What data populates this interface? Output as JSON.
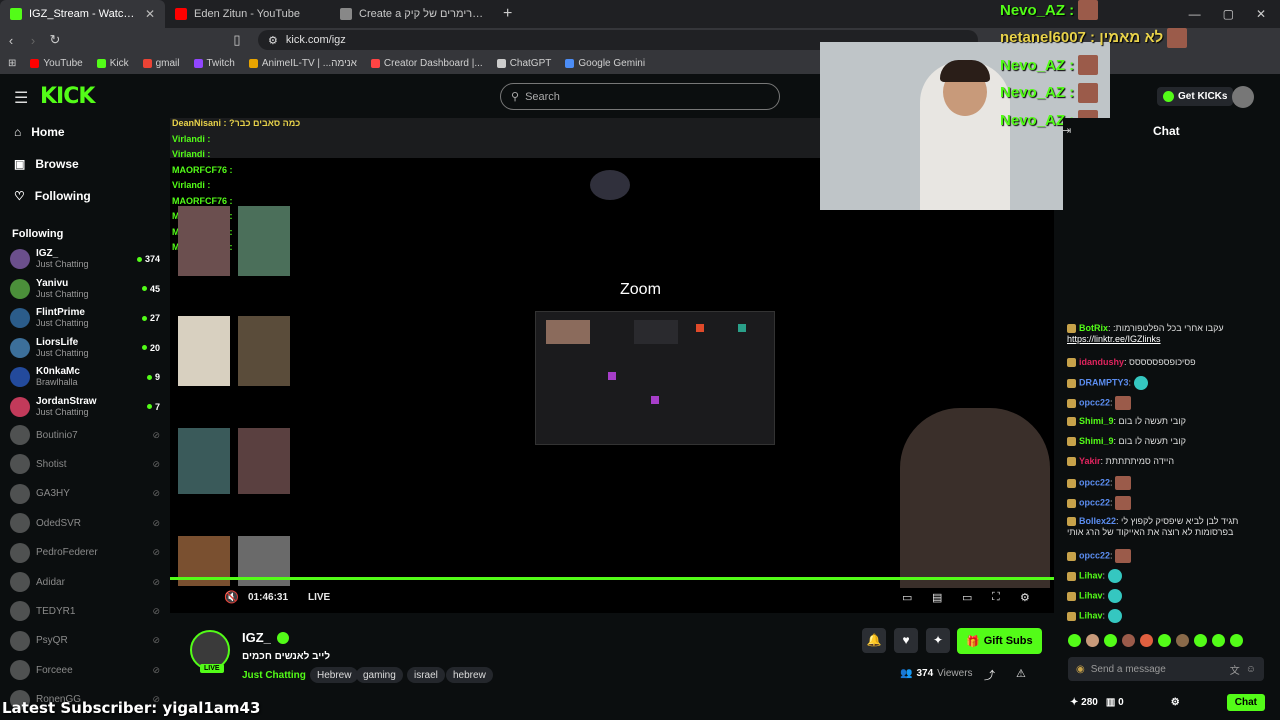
{
  "browser": {
    "tabs": [
      {
        "title": "IGZ_Stream - Watch Live on Kick",
        "color": "#53fc18",
        "active": true
      },
      {
        "title": "Eden Zitun - YouTube",
        "color": "#ff0000",
        "active": false
      },
      {
        "title": "Create a דירוג סטרימרים של קיק Tier",
        "color": "#888888",
        "active": false
      }
    ],
    "url": "kick.com/igz",
    "bookmarks": [
      {
        "label": "YouTube",
        "color": "#ff0000"
      },
      {
        "label": "Kick",
        "color": "#53fc18"
      },
      {
        "label": "gmail",
        "color": "#ea4335"
      },
      {
        "label": "Twitch",
        "color": "#9146ff"
      },
      {
        "label": "AnimeIL-TV | ...אנימה",
        "color": "#e8a400"
      },
      {
        "label": "Creator Dashboard |...",
        "color": "#ff4444"
      },
      {
        "label": "ChatGPT",
        "color": "#cccccc"
      },
      {
        "label": "Google Gemini",
        "color": "#4c8df6"
      }
    ]
  },
  "header": {
    "logo": "KICK",
    "search_placeholder": "Search",
    "get_kicks": "Get KICKs"
  },
  "sidebar": {
    "nav": [
      {
        "label": "Home",
        "icon": "home-icon"
      },
      {
        "label": "Browse",
        "icon": "browse-icon"
      },
      {
        "label": "Following",
        "icon": "heart-icon"
      }
    ],
    "following_title": "Following",
    "live_channels": [
      {
        "name": "IGZ_",
        "category": "Just Chatting",
        "viewers": "374",
        "color": "#6b4f8c"
      },
      {
        "name": "Yanivu",
        "category": "Just Chatting",
        "viewers": "45",
        "color": "#4b8f3a"
      },
      {
        "name": "FlintPrime",
        "category": "Just Chatting",
        "viewers": "27",
        "color": "#2b5c8a"
      },
      {
        "name": "LiorsLife",
        "category": "Just Chatting",
        "viewers": "20",
        "color": "#3c6f9a"
      },
      {
        "name": "K0nkaMc",
        "category": "Brawlhalla",
        "viewers": "9",
        "color": "#234a9c"
      },
      {
        "name": "JordanStraw",
        "category": "Just Chatting",
        "viewers": "7",
        "color": "#c23a5a"
      }
    ],
    "offline_channels": [
      {
        "name": "Boutinio7"
      },
      {
        "name": "Shotist"
      },
      {
        "name": "GA3HY"
      },
      {
        "name": "OdedSVR"
      },
      {
        "name": "PedroFederer"
      },
      {
        "name": "Adidar"
      },
      {
        "name": "TEDYR1"
      },
      {
        "name": "PsyQR"
      },
      {
        "name": "Forceee"
      },
      {
        "name": "RonenGG"
      }
    ]
  },
  "video": {
    "zoom_label": "Zoom",
    "time": "01:46:31",
    "live_label": "LIVE",
    "overlay_chat": [
      {
        "user": "DeanNisani",
        "text": "?כמה סאבים כבר",
        "color": "#e8d24a"
      },
      {
        "user": "Virlandi",
        "text": "",
        "color": "#53fc18"
      },
      {
        "user": "Virlandi",
        "text": "",
        "color": "#53fc18"
      },
      {
        "user": "MAORFCF76",
        "text": "",
        "color": "#53fc18"
      },
      {
        "user": "Virlandi",
        "text": "",
        "color": "#53fc18"
      },
      {
        "user": "MAORFCF76",
        "text": "",
        "color": "#53fc18"
      },
      {
        "user": "MAORFCF76",
        "text": "",
        "color": "#53fc18"
      },
      {
        "user": "MAORFCF76",
        "text": "",
        "color": "#53fc18"
      },
      {
        "user": "MAORFCF76",
        "text": "",
        "color": "#53fc18"
      }
    ]
  },
  "stream": {
    "name": "IGZ_",
    "title": "לייב לאנשים חכמים",
    "category": "Just Chatting",
    "tags": [
      "Hebrew",
      "gaming",
      "israel",
      "hebrew"
    ],
    "viewers": "374",
    "viewers_label": "Viewers",
    "gift_subs": "Gift Subs",
    "live_badge": "LIVE"
  },
  "overlay_top": [
    {
      "user": "Nevo_AZ :",
      "color": "#53fc18"
    },
    {
      "user": "netanel6007 : לא מאמין",
      "color": "#e8d24a"
    },
    {
      "user": "Nevo_AZ :",
      "color": "#53fc18"
    },
    {
      "user": "Nevo_AZ :",
      "color": "#53fc18"
    },
    {
      "user": "Nevo_AZ :",
      "color": "#53fc18"
    }
  ],
  "latest_subscriber": "Latest Subscriber: yigal1am43",
  "chat": {
    "title": "Chat",
    "input_placeholder": "Send a message",
    "kicks": "280",
    "zero": "0",
    "chat_button": "Chat",
    "messages": [
      {
        "user": "BotRix",
        "text": ":עקבו אחרי בכל הפלטפורמות",
        "link": "https://linktr.ee/IGZlinks",
        "color": "#53fc18"
      },
      {
        "user": "idandushy",
        "text": "פסיכופספססססס",
        "color": "#e0245e"
      },
      {
        "user": "DRAMPTY3",
        "text": "",
        "color": "#5b8df0"
      },
      {
        "user": "opcc22",
        "text": "",
        "color": "#5b8df0"
      },
      {
        "user": "Shimi_9",
        "text": "קובי תעשה לו בום",
        "color": "#53fc18"
      },
      {
        "user": "Shimi_9",
        "text": "קובי תעשה לו בום",
        "color": "#53fc18"
      },
      {
        "user": "Yakir",
        "text": "היידה סמיתתתתת",
        "color": "#e0245e"
      },
      {
        "user": "opcc22",
        "text": "",
        "color": "#5b8df0"
      },
      {
        "user": "opcc22",
        "text": "",
        "color": "#5b8df0"
      },
      {
        "user": "Bollex22",
        "text": "תגיד לבן לביא שיפסיק לקפוץ לי בפרסומות לא רוצה את האייקוד של הרג אותי",
        "color": "#5b8df0"
      },
      {
        "user": "opcc22",
        "text": "",
        "color": "#5b8df0"
      },
      {
        "user": "Lihav",
        "text": "",
        "color": "#53fc18"
      },
      {
        "user": "Lihav",
        "text": "",
        "color": "#53fc18"
      },
      {
        "user": "Lihav",
        "text": "",
        "color": "#53fc18"
      }
    ]
  }
}
